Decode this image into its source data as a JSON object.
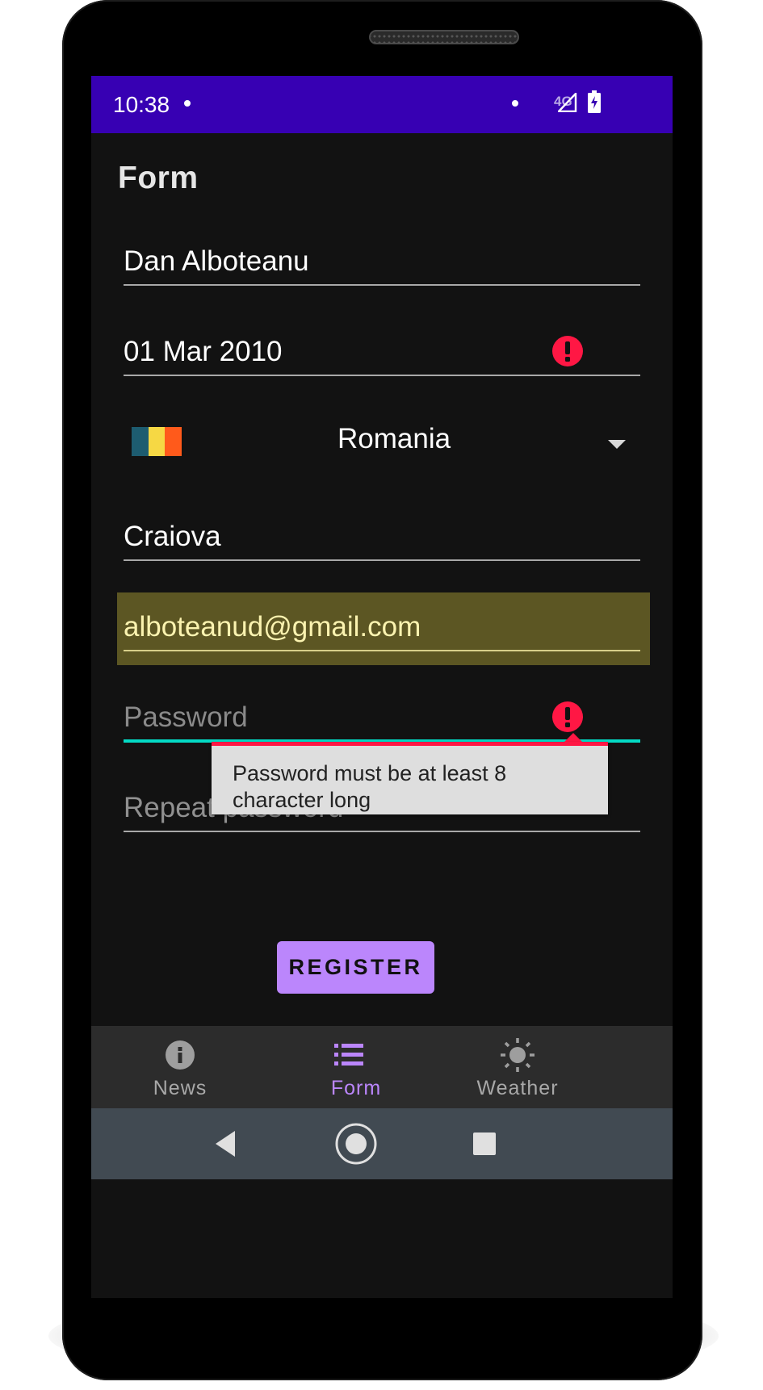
{
  "status_bar": {
    "time": "10:38",
    "network": "4G"
  },
  "app_bar": {
    "title": "Form"
  },
  "form": {
    "name": {
      "value": "Dan Alboteanu"
    },
    "birth_date": {
      "value": "01 Mar 2010",
      "has_error": true
    },
    "country": {
      "value": "Romania",
      "flag_colors": [
        "#1d5c70",
        "#f6d844",
        "#ff5a1b"
      ]
    },
    "city": {
      "value": "Craiova"
    },
    "email": {
      "value": "alboteanud@gmail.com",
      "highlight_color": "#5c5623"
    },
    "password": {
      "placeholder": "Password",
      "has_error": true
    },
    "repeat_password": {
      "placeholder": "Repeat password"
    },
    "password_error": "Password must be at least 8 character long",
    "register_label": "REGISTER"
  },
  "bottom_nav": {
    "items": [
      {
        "label": "News",
        "icon": "info-icon",
        "selected": false
      },
      {
        "label": "Form",
        "icon": "list-icon",
        "selected": true
      },
      {
        "label": "Weather",
        "icon": "sun-icon",
        "selected": false
      }
    ]
  },
  "colors": {
    "primary": "#bb86fc",
    "status_bar": "#3700b3",
    "error": "#ff1744",
    "focus_underline": "#03dac5",
    "background": "#121212"
  }
}
